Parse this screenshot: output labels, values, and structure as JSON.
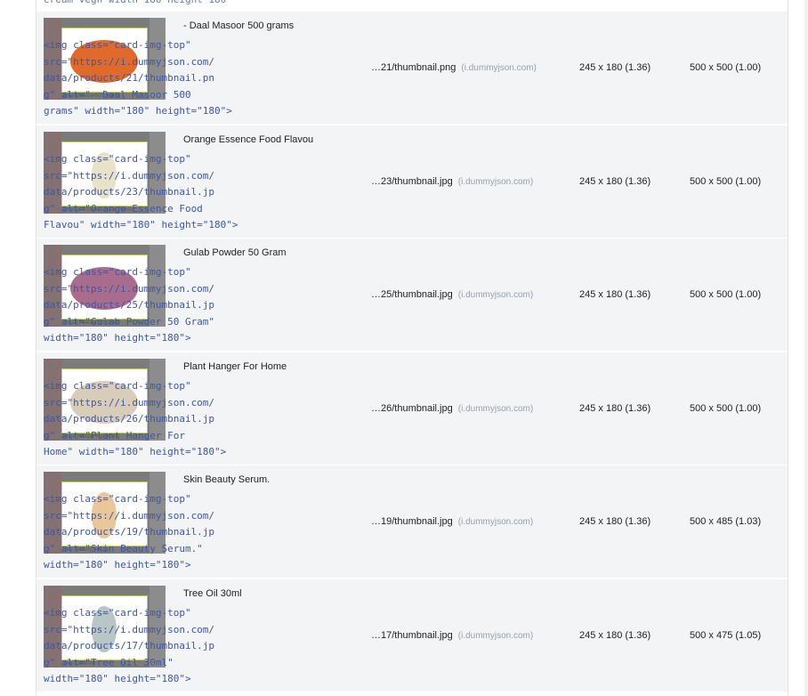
{
  "cut_off_text": "cream  vegn  width  180  height  180",
  "rows": [
    {
      "name": "- Daal Masoor 500 grams",
      "code": "<img class=\"card-img-top\"\nsrc=\"https://i.dummyjson.com/\ndata/products/21/thumbnail.pn\ng\" alt=\"- Daal Masoor 500\ngrams\" width=\"180\" height=\"180\">",
      "url": "…21/thumbnail.png",
      "domain": "(i.dummyjson.com)",
      "rendered": "245 x 180 (1.36)",
      "intrinsic": "500 x 500 (1.00)",
      "thumb_color": "#e06a2a",
      "caption": "Daal Masoor 500 grams"
    },
    {
      "name": "Orange Essence Food Flavou",
      "code": "<img class=\"card-img-top\"\nsrc=\"https://i.dummyjson.com/\ndata/products/23/thumbnail.jp\ng\" alt=\"Orange Essence Food\nFlavou\" width=\"180\" height=\"180\">",
      "url": "…23/thumbnail.jpg",
      "domain": "(i.dummyjson.com)",
      "rendered": "245 x 180 (1.36)",
      "intrinsic": "500 x 500 (1.00)",
      "thumb_color": "#e7e2c8",
      "caption": "Orange Essence Food Flavou"
    },
    {
      "name": "Gulab Powder 50 Gram",
      "code": "<img class=\"card-img-top\"\nsrc=\"https://i.dummyjson.com/\ndata/products/25/thumbnail.jp\ng\" alt=\"Gulab Powder 50 Gram\"\nwidth=\"180\" height=\"180\">",
      "url": "…25/thumbnail.jpg",
      "domain": "(i.dummyjson.com)",
      "rendered": "245 x 180 (1.36)",
      "intrinsic": "500 x 500 (1.00)",
      "thumb_color": "#a86d8c",
      "caption": "Gulab Powder 50 Gram"
    },
    {
      "name": "Plant Hanger For Home",
      "code": "<img class=\"card-img-top\"\nsrc=\"https://i.dummyjson.com/\ndata/products/26/thumbnail.jp\ng\" alt=\"Plant Hanger For\nHome\" width=\"180\" height=\"180\">",
      "url": "…26/thumbnail.jpg",
      "domain": "(i.dummyjson.com)",
      "rendered": "245 x 180 (1.36)",
      "intrinsic": "500 x 500 (1.00)",
      "thumb_color": "#d8cdb8",
      "caption": "Plant Hanger For Home"
    },
    {
      "name": "Skin Beauty Serum.",
      "code": "<img class=\"card-img-top\"\nsrc=\"https://i.dummyjson.com/\ndata/products/19/thumbnail.jp\ng\" alt=\"Skin Beauty Serum.\"\nwidth=\"180\" height=\"180\">",
      "url": "…19/thumbnail.jpg",
      "domain": "(i.dummyjson.com)",
      "rendered": "245 x 180 (1.36)",
      "intrinsic": "500 x 485 (1.03)",
      "thumb_color": "#e9c79b",
      "caption": "Skin Beauty Serum."
    },
    {
      "name": "Tree Oil 30ml",
      "code": "<img class=\"card-img-top\"\nsrc=\"https://i.dummyjson.com/\ndata/products/17/thumbnail.jp\ng\" alt=\"Tree Oil 30ml\"\nwidth=\"180\" height=\"180\">",
      "url": "…17/thumbnail.jpg",
      "domain": "(i.dummyjson.com)",
      "rendered": "245 x 180 (1.36)",
      "intrinsic": "500 x 475 (1.05)",
      "thumb_color": "#b9c6c4",
      "caption": "Tree Oil 30ml"
    }
  ]
}
